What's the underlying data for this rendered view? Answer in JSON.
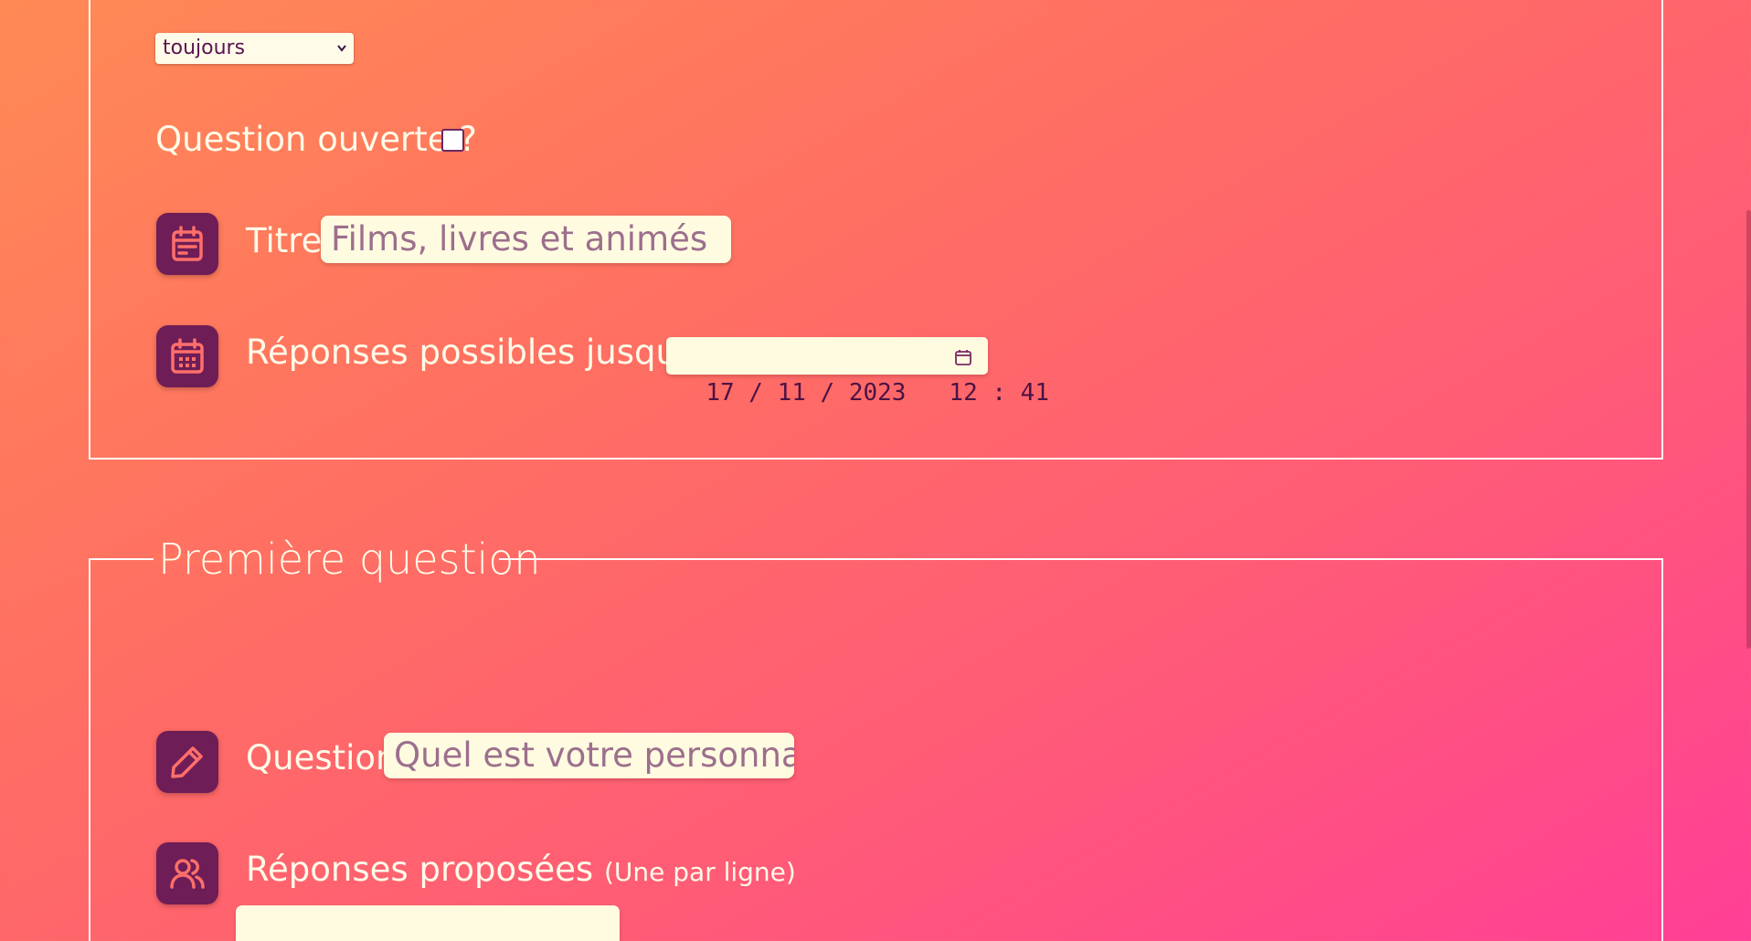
{
  "settings": {
    "visibility_select": {
      "value": "toujours"
    },
    "open_question_label": "Question ouverte ?",
    "open_question_checked": false,
    "title_label": "Titre",
    "title_placeholder": "Films, livres et animés",
    "deadline_label": "Réponses possibles jusqu'au",
    "deadline_value": "17 / 11 / 2023   12 : 41"
  },
  "first_question": {
    "legend": "Première question",
    "question_label": "Question",
    "question_placeholder": "Quel est votre personnage",
    "answers_label": "Réponses proposées",
    "answers_hint": "(Une par ligne)",
    "answers_value": ""
  },
  "icons": {
    "title": "calendar-page-icon",
    "deadline": "calendar-grid-icon",
    "question": "pencil-icon",
    "answers": "users-icon",
    "date_picker": "calendar-small-icon",
    "select": "chevron-down-icon"
  },
  "colors": {
    "badge": "#6e1d57",
    "icon": "#ff6f6a",
    "input_bg": "#fffbe0",
    "placeholder": "#9c6f8d",
    "text": "#fffbe9"
  }
}
